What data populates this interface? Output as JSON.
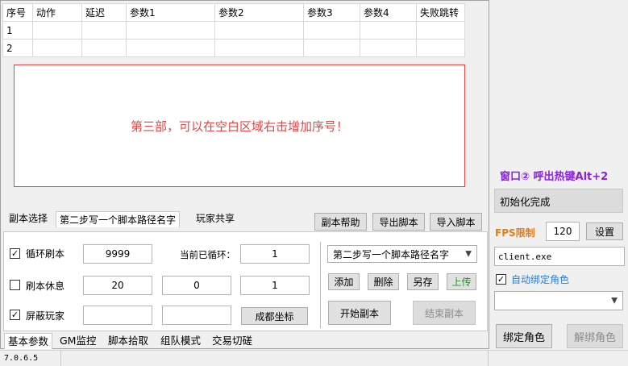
{
  "table": {
    "headers": [
      "序号",
      "动作",
      "延迟",
      "参数1",
      "参数2",
      "参数3",
      "参数4",
      "失败跳转"
    ],
    "rows": [
      [
        "1",
        "",
        "",
        "",
        "",
        "",
        "",
        ""
      ],
      [
        "2",
        "",
        "",
        "",
        "",
        "",
        "",
        ""
      ]
    ]
  },
  "hint": "第三部，可以在空白区域右击增加序号！",
  "script_tabs": {
    "tab1": "副本选择",
    "tab2": "第二步写一个脚本路径名字",
    "tab3": "玩家共享"
  },
  "script_buttons": {
    "help": "副本帮助",
    "export": "导出脚本",
    "import": "导入脚本"
  },
  "params": {
    "loop_label": "循环刷本",
    "loop_checked": true,
    "loop_value": "9999",
    "current_loop_label": "当前已循环：",
    "current_loop_value": "1",
    "rest_label": "刷本休息",
    "rest_checked": false,
    "rest_value1": "20",
    "rest_value2": "0",
    "rest_value3": "1",
    "block_label": "屏蔽玩家",
    "block_checked": true,
    "block_value1": "",
    "block_value2": "",
    "capital_coords_button": "成都坐标"
  },
  "script_control": {
    "select_value": "第二步写一个脚本路径名字",
    "add": "添加",
    "delete": "删除",
    "save_as": "另存",
    "upload": "上传",
    "start": "开始副本",
    "end": "结束副本"
  },
  "bottom_tabs": [
    "基本参数",
    "GM监控",
    "脚本拾取",
    "组队模式",
    "交易切磋"
  ],
  "status_bar": {
    "version": "7.0.6.5"
  },
  "right_panel": {
    "window_title": "窗口② 呼出热键Alt+2",
    "init_status": "初始化完成",
    "fps_label": "FPS限制",
    "fps_value": "120",
    "settings_button": "设置",
    "process_name": "client.exe",
    "auto_bind_label": "自动绑定角色",
    "auto_bind_checked": true,
    "role_select": "",
    "bind_button": "绑定角色",
    "unbind_button": "解绑角色"
  },
  "colors": {
    "accent_purple": "#8b1fe0",
    "hint_red": "#e04848",
    "fps_orange": "#e27e1a",
    "upload_green": "#2e8b2e"
  }
}
